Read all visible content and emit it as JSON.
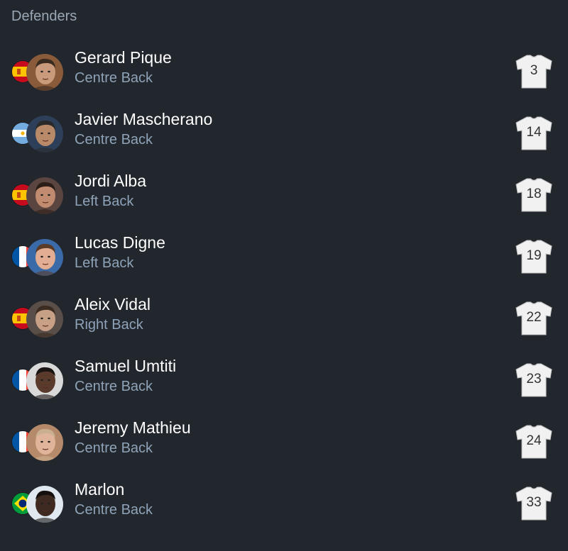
{
  "section": {
    "title": "Defenders"
  },
  "players": [
    {
      "name": "Gerard Pique",
      "position": "Centre Back",
      "number": "3",
      "flag": "spain",
      "skin": "#c99a7c",
      "hair": "#3a2a20",
      "bg": "#8a5b3a"
    },
    {
      "name": "Javier Mascherano",
      "position": "Centre Back",
      "number": "14",
      "flag": "argentina",
      "skin": "#b88a6a",
      "hair": "#2a2a2a",
      "bg": "#2e3f59"
    },
    {
      "name": "Jordi Alba",
      "position": "Left Back",
      "number": "18",
      "flag": "spain",
      "skin": "#c08b6e",
      "hair": "#2b1d17",
      "bg": "#5a4540"
    },
    {
      "name": "Lucas Digne",
      "position": "Left Back",
      "number": "19",
      "flag": "france",
      "skin": "#e2ad92",
      "hair": "#5a3b28",
      "bg": "#3a6aa8"
    },
    {
      "name": "Aleix Vidal",
      "position": "Right Back",
      "number": "22",
      "flag": "spain",
      "skin": "#c8a086",
      "hair": "#3c2c22",
      "bg": "#5a4f48"
    },
    {
      "name": "Samuel Umtiti",
      "position": "Centre Back",
      "number": "23",
      "flag": "france",
      "skin": "#5a3a2a",
      "hair": "#1a1412",
      "bg": "#d9d9d9"
    },
    {
      "name": "Jeremy Mathieu",
      "position": "Centre Back",
      "number": "24",
      "flag": "france",
      "skin": "#e0b49a",
      "hair": "#c9b08f",
      "bg": "#b48a6a"
    },
    {
      "name": "Marlon",
      "position": "Centre Back",
      "number": "33",
      "flag": "brazil",
      "skin": "#3e2a20",
      "hair": "#15100d",
      "bg": "#dfe8ef"
    }
  ],
  "colors": {
    "background": "#22262d",
    "name": "#ffffff",
    "position": "#8fa3b8",
    "header": "#9aa7b4",
    "shirt": "#f1f1f1"
  },
  "icons": {
    "shirt": "jersey-icon"
  }
}
